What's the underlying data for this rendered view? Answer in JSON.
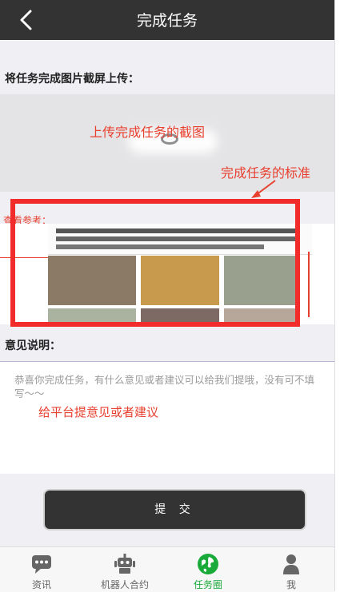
{
  "header": {
    "title": "完成任务"
  },
  "upload": {
    "label": "将任务完成图片截屏上传："
  },
  "annotations": {
    "upload_hint": "上传完成任务的截图",
    "standard_hint": "完成任务的标准",
    "opinion_hint": "给平台提意见或者建议"
  },
  "reference": {
    "label": "查看参考："
  },
  "opinion": {
    "label": "意见说明：",
    "value": "",
    "placeholder": "恭喜你完成任务，有什么意见或者建议可以给我们提哦，没有可不填写～～"
  },
  "submit_label": "提 交",
  "tabbar": {
    "items": [
      {
        "label": "资讯",
        "icon": "chat-bubble-icon"
      },
      {
        "label": "机器人合约",
        "icon": "robot-icon"
      },
      {
        "label": "任务圈",
        "icon": "globe-icon",
        "active": true
      },
      {
        "label": "我",
        "icon": "user-icon"
      }
    ]
  },
  "colors": {
    "header_bg": "#333333",
    "accent_green": "#1aaa3a",
    "annotation_red": "#e8402f"
  }
}
